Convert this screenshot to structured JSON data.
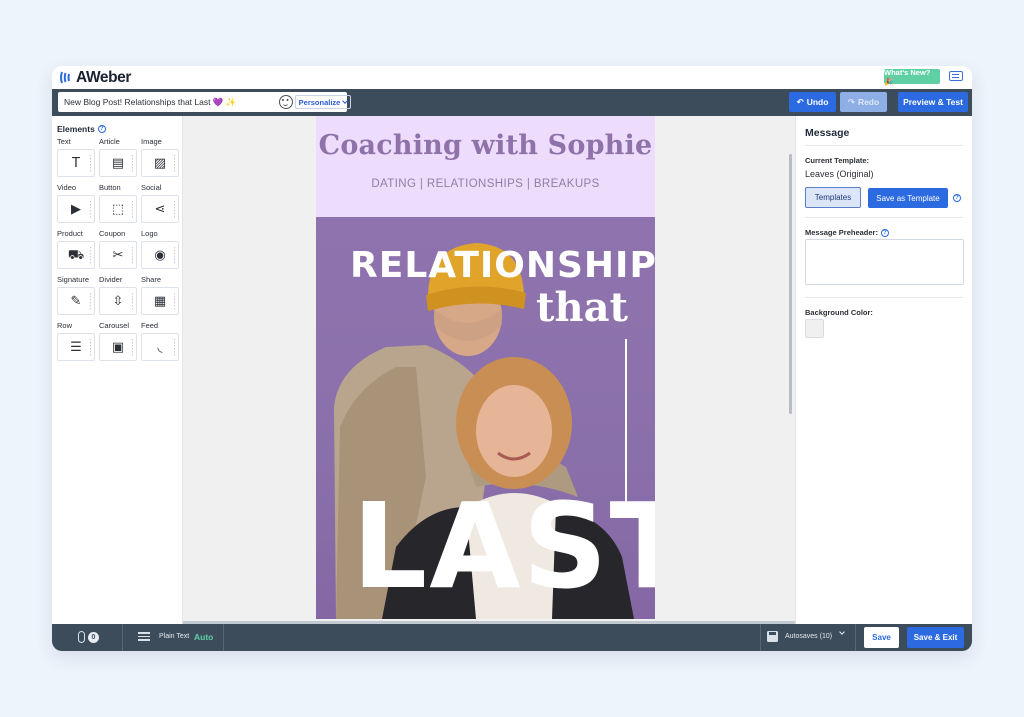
{
  "brand": {
    "name": "AWeber",
    "whats_new": "What's New? 🎉"
  },
  "toolbar": {
    "subject": "New Blog Post! Relationships that Last 💜 ✨",
    "personalize": "Personalize",
    "undo": "Undo",
    "redo": "Redo",
    "preview": "Preview & Test"
  },
  "elements": {
    "title": "Elements",
    "items": [
      {
        "label": "Text",
        "icon": "T"
      },
      {
        "label": "Article",
        "icon": "▤"
      },
      {
        "label": "Image",
        "icon": "▨"
      },
      {
        "label": "Video",
        "icon": "▶"
      },
      {
        "label": "Button",
        "icon": "⬚"
      },
      {
        "label": "Social",
        "icon": "⋖"
      },
      {
        "label": "Product",
        "icon": "⛟"
      },
      {
        "label": "Coupon",
        "icon": "✂"
      },
      {
        "label": "Logo",
        "icon": "◉"
      },
      {
        "label": "Signature",
        "icon": "✎"
      },
      {
        "label": "Divider",
        "icon": "⇳"
      },
      {
        "label": "Share",
        "icon": "▦"
      },
      {
        "label": "Row",
        "icon": "☰"
      },
      {
        "label": "Carousel",
        "icon": "▣"
      },
      {
        "label": "Feed",
        "icon": "◟"
      }
    ]
  },
  "email": {
    "title": "Coaching with Sophie",
    "tagline": "DATING | RELATIONSHIPS | BREAKUPS",
    "hero_line1": "RELATIONSHIPS",
    "hero_line2": "that",
    "hero_line3": "LAST"
  },
  "message_panel": {
    "title": "Message",
    "current_template_label": "Current Template:",
    "current_template_value": "Leaves (Original)",
    "templates_button": "Templates",
    "save_template_button": "Save as Template",
    "preheader_label": "Message Preheader:",
    "background_label": "Background Color:",
    "background_color": "#f0f0f0"
  },
  "bottom": {
    "attachments": "0",
    "plain_text_label": "Plain Text",
    "plain_text_value": "Auto",
    "autosaves": "Autosaves (10)",
    "save": "Save",
    "save_exit": "Save & Exit"
  },
  "colors": {
    "accent": "#2b6ae0",
    "toolbar": "#3c4c5b",
    "header_bg": "#eddcfb",
    "hero_bg": "#8f73ae",
    "whats_new": "#5fd0a3"
  }
}
